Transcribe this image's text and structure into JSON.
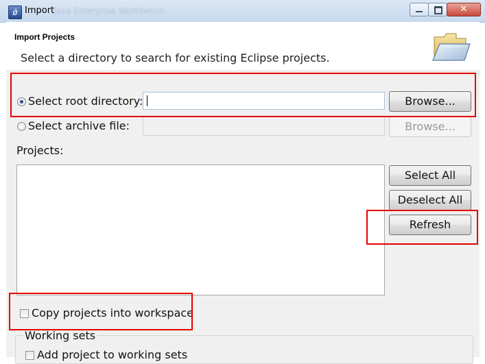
{
  "window": {
    "title": "Import",
    "blurred_title": "Java Enterprise Workbench",
    "close_glyph": "✕"
  },
  "header": {
    "title": "Import Projects",
    "description": "Select a directory to search for existing Eclipse projects."
  },
  "source": {
    "root_directory": {
      "label": "Select root directory:",
      "value": "",
      "selected": true,
      "browse_label": "Browse..."
    },
    "archive_file": {
      "label": "Select archive file:",
      "value": "",
      "selected": false,
      "browse_label": "Browse..."
    }
  },
  "projects": {
    "label": "Projects:",
    "items": [],
    "buttons": {
      "select_all": "Select All",
      "deselect_all": "Deselect All",
      "refresh": "Refresh"
    }
  },
  "options": {
    "copy_into_workspace": {
      "label": "Copy projects into workspace",
      "checked": false
    }
  },
  "working_sets": {
    "group_label": "Working sets",
    "add_to_working_sets": {
      "label": "Add project to working sets",
      "checked": false
    }
  },
  "icons": {
    "app": "eclipse-icon",
    "header": "open-folder-icon"
  },
  "colors": {
    "annotation": "#e60000",
    "titlebar": "#c7d9ef",
    "dialog_bg": "#f0f0f0"
  }
}
